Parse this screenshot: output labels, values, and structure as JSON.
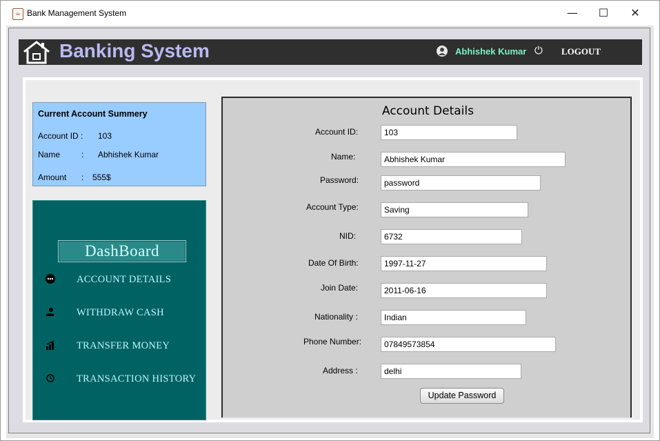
{
  "window": {
    "title": "Bank Management System",
    "controls": {
      "minimize": "—",
      "maximize": "☐",
      "close": "✕"
    }
  },
  "header": {
    "brand": "Banking System",
    "user_name": "Abhishek Kumar",
    "logout_label": "LOGOUT",
    "brand_color": "#b9b9f0",
    "user_color": "#7cf2c2"
  },
  "summary": {
    "title": "Current Account Summery",
    "rows": [
      {
        "label": "Account ID :",
        "colon": "",
        "value": "103"
      },
      {
        "label": "Name",
        "colon": ":",
        "value": "Abhishek Kumar"
      },
      {
        "label": "Amount",
        "colon": ":",
        "value": "555$"
      }
    ]
  },
  "sidebar": {
    "dashboard_label": "DashBoard",
    "items": [
      {
        "label": "ACCOUNT DETAILS",
        "icon": "user-circle-icon"
      },
      {
        "label": "WITHDRAW CASH",
        "icon": "cash-hand-icon"
      },
      {
        "label": "TRANSFER MONEY",
        "icon": "transfer-chart-icon"
      },
      {
        "label": "TRANSACTION HISTORY",
        "icon": "history-clock-icon"
      }
    ]
  },
  "details": {
    "title": "Account Details",
    "fields": [
      {
        "label": "Account ID:",
        "value": "103"
      },
      {
        "label": "Name:",
        "value": "Abhishek Kumar"
      },
      {
        "label": "Password:",
        "value": "password"
      },
      {
        "label": "Account Type:",
        "value": "Saving"
      },
      {
        "label": "NID:",
        "value": "6732"
      },
      {
        "label": "Date Of Birth:",
        "value": "1997-11-27"
      },
      {
        "label": "Join Date:",
        "value": "2011-06-16"
      },
      {
        "label": "Nationality :",
        "value": "Indian"
      },
      {
        "label": "Phone Number:",
        "value": "07849573854"
      },
      {
        "label": "Address :",
        "value": "delhi"
      }
    ],
    "update_button": "Update Password"
  }
}
